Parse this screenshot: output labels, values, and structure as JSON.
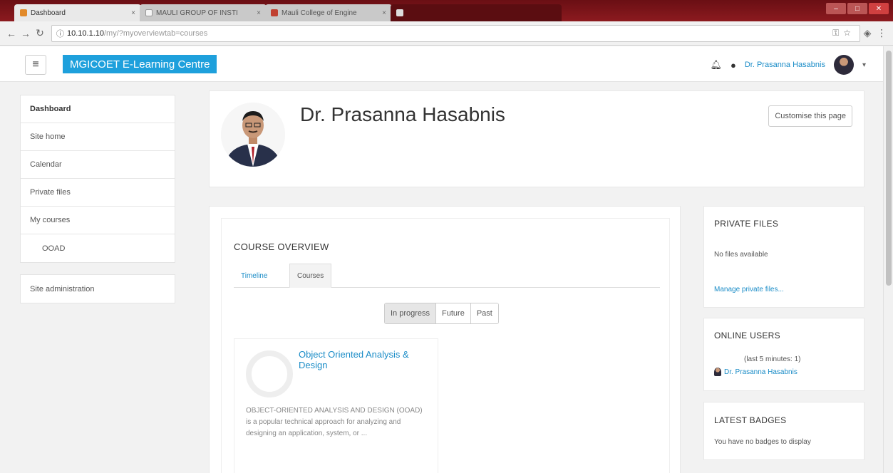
{
  "browser": {
    "tabs": [
      {
        "label": "Dashboard",
        "state": "active"
      },
      {
        "label": "MAULI GROUP OF INSTI",
        "state": "inactive"
      },
      {
        "label": "Mauli College of Engine",
        "state": "inactive"
      },
      {
        "label": "",
        "state": "dark"
      }
    ],
    "url_host": "10.10.1.10",
    "url_path": "/my/?myoverviewtab=courses"
  },
  "navbar": {
    "brand": "MGICOET E-Learning Centre",
    "user_name": "Dr. Prasanna Hasabnis"
  },
  "drawer": {
    "items": [
      "Dashboard",
      "Site home",
      "Calendar",
      "Private files",
      "My courses",
      "OOAD"
    ],
    "admin": "Site administration"
  },
  "header": {
    "name": "Dr. Prasanna Hasabnis",
    "customise": "Customise this page"
  },
  "overview": {
    "title": "COURSE OVERVIEW",
    "tab_timeline": "Timeline",
    "tab_courses": "Courses",
    "filters": [
      "In progress",
      "Future",
      "Past"
    ],
    "course": {
      "name": "Object Oriented Analysis & Design",
      "summary": "OBJECT-ORIENTED ANALYSIS AND DESIGN (OOAD) is a popular technical approach for analyzing and designing an application, system, or ..."
    }
  },
  "blocks": {
    "private_files": {
      "title": "PRIVATE FILES",
      "empty": "No files available",
      "manage": "Manage private files..."
    },
    "online_users": {
      "title": "ONLINE USERS",
      "period": "(last 5 minutes: 1)",
      "user": "Dr. Prasanna Hasabnis"
    },
    "latest_badges": {
      "title": "LATEST BADGES",
      "empty": "You have no badges to display"
    }
  },
  "colors": {
    "brand": "#1ea0dc",
    "link": "#1a8cc7",
    "tabstrip": "#8c1a1f"
  }
}
